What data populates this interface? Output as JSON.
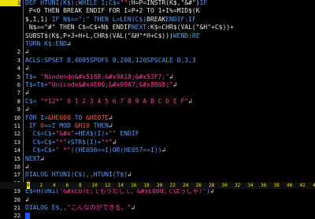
{
  "lines": [
    {
      "num": "1",
      "current": true,
      "segs": [
        {
          "c": "kw",
          "t": "DEF HTUNI(K$)"
        },
        {
          "c": "df",
          "t": ":"
        },
        {
          "c": "kw",
          "t": "WHILE 1"
        },
        {
          "c": "df",
          "t": ":"
        },
        {
          "c": "kw",
          "t": "C$="
        },
        {
          "c": "st",
          "t": "\"\""
        },
        {
          "c": "df",
          "t": ":H=P=INSTR(K$,\"&#\")"
        },
        {
          "c": "kw",
          "t": "IF"
        }
      ]
    },
    {
      "num": "",
      "segs": [
        {
          "c": "df",
          "t": " P<0 THEN BREAK ENDIF FOR I=P+2 TO 1+I%=MID$(K"
        }
      ]
    },
    {
      "num": "",
      "segs": [
        {
          "c": "df",
          "t": "$,I,1)"
        },
        {
          "c": "kw",
          "t": " IF N$==\";\" THEN L=LEN(C$)"
        },
        {
          "c": "df",
          "t": "BREAK"
        },
        {
          "c": "kw",
          "t": "ENDIF:IF"
        }
      ]
    },
    {
      "num": "",
      "segs": [
        {
          "c": "df",
          "t": " N$==\"#\" THEN C$=C$+N$ ENDIF"
        },
        {
          "c": "kw",
          "t": "NEXT"
        },
        {
          "c": "df",
          "t": ":K$=CHR$(VAL(\"&H\"+C$))+"
        }
      ]
    },
    {
      "num": "",
      "segs": [
        {
          "c": "df",
          "t": "SUBST$(K$,P+3+H+L,CHR$(VAL(\"&H\"*H+C$)))"
        },
        {
          "c": "kw",
          "t": "WEND:RE"
        }
      ]
    },
    {
      "num": "",
      "segs": [
        {
          "c": "kw",
          "t": "TURN K$:END"
        },
        {
          "c": "df",
          "t": "↲"
        }
      ]
    },
    {
      "num": "2",
      "segs": [
        {
          "c": "df",
          "t": "↲"
        }
      ]
    },
    {
      "num": "3",
      "segs": [
        {
          "c": "kw",
          "t": "ACLS:SPSET 0,4095"
        },
        {
          "c": "kw",
          "t": "SPOFS 0,200,120"
        },
        {
          "c": "kw",
          "t": "SPSCALE 0,3,3"
        }
      ]
    },
    {
      "num": "4",
      "segs": [
        {
          "c": "df",
          "t": "↲"
        }
      ]
    },
    {
      "num": "5",
      "segs": [
        {
          "c": "kw",
          "t": "T$= "
        },
        {
          "c": "st",
          "t": "\"Nindendo&#x5168;&#x9A18;&#x53F7;\""
        },
        {
          "c": "df",
          "t": "↲"
        }
      ]
    },
    {
      "num": "6",
      "segs": [
        {
          "c": "kw",
          "t": "T$=T$+"
        },
        {
          "c": "st",
          "t": "\"Unicode&#x4E00;&#x89A7;&#x8868;\""
        },
        {
          "c": "df",
          "t": "↲"
        }
      ]
    },
    {
      "num": "7",
      "segs": [
        {
          "c": "df",
          "t": "↲"
        }
      ]
    },
    {
      "num": "8",
      "segs": [
        {
          "c": "kw",
          "t": "C$= "
        },
        {
          "c": "st",
          "t": "\"*12*\" 0 1 2 3 4 5 6 7 8 9 A B C D E F\""
        },
        {
          "c": "df",
          "t": "↲"
        }
      ]
    },
    {
      "num": "9",
      "segs": [
        {
          "c": "df",
          "t": "↲"
        }
      ]
    },
    {
      "num": "10",
      "segs": [
        {
          "c": "kw",
          "t": "FOR I="
        },
        {
          "c": "nm",
          "t": "&HE000"
        },
        {
          "c": "kw",
          "t": " TO "
        },
        {
          "c": "nm",
          "t": "&HE07E"
        },
        {
          "c": "df",
          "t": "↲"
        }
      ]
    },
    {
      "num": "11",
      "segs": [
        {
          "c": "kw",
          "t": " IF "
        },
        {
          "c": "nm",
          "t": "0"
        },
        {
          "c": "kw",
          "t": "==I MOD "
        },
        {
          "c": "nm",
          "t": "&H10"
        },
        {
          "c": "kw",
          "t": " THEN"
        },
        {
          "c": "df",
          "t": "↲"
        }
      ]
    },
    {
      "num": "12",
      "segs": [
        {
          "c": "kw",
          "t": "  C$=C$+"
        },
        {
          "c": "st",
          "t": "\"&#x\""
        },
        {
          "c": "kw",
          "t": "+HEX$(I)+"
        },
        {
          "c": "st",
          "t": "\"\""
        },
        {
          "c": "kw",
          "t": " ENDIF"
        }
      ]
    },
    {
      "num": "13",
      "segs": [
        {
          "c": "kw",
          "t": "  C$=C$+"
        },
        {
          "c": "st",
          "t": "\"*\""
        },
        {
          "c": "kw",
          "t": "+STR$(I)+"
        },
        {
          "c": "st",
          "t": "\"*\""
        },
        {
          "c": "df",
          "t": "↲"
        }
      ]
    },
    {
      "num": "14",
      "segs": [
        {
          "c": "kw",
          "t": "  C$=C$+"
        },
        {
          "c": "st",
          "t": "\" *\""
        },
        {
          "c": "kw",
          "t": "((HE056==I)OR(HE057==I))"
        },
        {
          "c": "df",
          "t": "↲"
        }
      ]
    },
    {
      "num": "15",
      "segs": [
        {
          "c": "kw",
          "t": "NEXT"
        },
        {
          "c": "df",
          "t": "↲"
        }
      ]
    },
    {
      "num": "16",
      "segs": [
        {
          "c": "df",
          "t": "↲"
        }
      ]
    },
    {
      "num": "17",
      "segs": [
        {
          "c": "kw",
          "t": "DIALOG HTUNI(C$),,HTUNI(T$)"
        },
        {
          "c": "df",
          "t": "↲"
        }
      ]
    },
    {
      "num": "18",
      "segs": [
        {
          "c": "df",
          "t": "↲"
        }
      ]
    },
    {
      "num": "19",
      "segs": [
        {
          "c": "kw",
          "t": "E$=HTUNI("
        },
        {
          "c": "st",
          "t": "\"&#xE07E;でもうたして、&#xE000;ではっしゃ!\""
        },
        {
          "c": "kw",
          "t": ")"
        },
        {
          "c": "df",
          "t": "↲"
        }
      ]
    },
    {
      "num": "20",
      "segs": [
        {
          "c": "df",
          "t": "↲"
        }
      ]
    },
    {
      "num": "21",
      "segs": [
        {
          "c": "kw",
          "t": "DIALOG E$,,"
        },
        {
          "c": "st",
          "t": "\"こんなのができる。\""
        },
        {
          "c": "df",
          "t": "↲"
        }
      ]
    },
    {
      "num": "22",
      "segs": [
        {
          "c": "df",
          "t": ""
        }
      ]
    }
  ],
  "ruler": [
    "0",
    "2",
    "4",
    "6",
    "8",
    "10",
    "12",
    "14",
    "16",
    "18",
    "20",
    "22",
    "24",
    "26",
    "28",
    "30",
    "32",
    "34",
    "36",
    "38",
    "40",
    "42",
    "44"
  ],
  "ruler_current": "0"
}
